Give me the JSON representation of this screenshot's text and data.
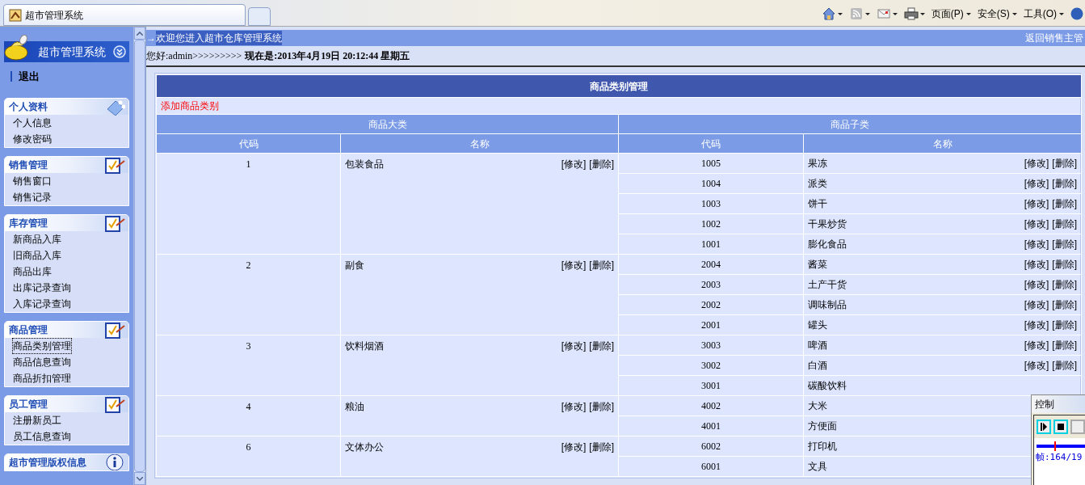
{
  "browser": {
    "tab_title": "超市管理系统",
    "menus": [
      "页面(P)",
      "安全(S)",
      "工具(O)"
    ]
  },
  "sidebar": {
    "title": "超市管理系统",
    "logout": "退出",
    "sections": [
      {
        "title": "个人资料",
        "kind": "people",
        "items": [
          {
            "label": "个人信息",
            "selected": false
          },
          {
            "label": "修改密码",
            "selected": false
          }
        ]
      },
      {
        "title": "销售管理",
        "kind": "checklist",
        "items": [
          {
            "label": "销售窗口",
            "selected": false
          },
          {
            "label": "销售记录",
            "selected": false
          }
        ]
      },
      {
        "title": "库存管理",
        "kind": "checklist",
        "items": [
          {
            "label": "新商品入库",
            "selected": false
          },
          {
            "label": "旧商品入库",
            "selected": false
          },
          {
            "label": "商品出库",
            "selected": false
          },
          {
            "label": "出库记录查询",
            "selected": false
          },
          {
            "label": "入库记录查询",
            "selected": false
          }
        ]
      },
      {
        "title": "商品管理",
        "kind": "checklist",
        "items": [
          {
            "label": "商品类别管理",
            "selected": true
          },
          {
            "label": "商品信息查询",
            "selected": false
          },
          {
            "label": "商品折扣管理",
            "selected": false
          }
        ]
      },
      {
        "title": "员工管理",
        "kind": "checklist",
        "items": [
          {
            "label": "注册新员工",
            "selected": false
          },
          {
            "label": "员工信息查询",
            "selected": false
          }
        ]
      },
      {
        "title": "超市管理版权信息",
        "kind": "info"
      }
    ]
  },
  "header": {
    "arrow": "→",
    "welcome": "欢迎您进入超市仓库管理系统",
    "back_link": "返回销售主管",
    "greeting": "您好:admin>>>>>>>>>",
    "now": "现在是:2013年4月19日  20:12:44 星期五"
  },
  "table": {
    "title": "商品类别管理",
    "add_link": "添加商品类别",
    "group_headers": [
      "商品大类",
      "商品子类"
    ],
    "columns": [
      "代码",
      "名称",
      "代码",
      "名称"
    ],
    "groups": [
      {
        "code": "1",
        "name": "包装食品",
        "actions": [
          "[修改]",
          "[删除]"
        ],
        "subs": [
          {
            "code": "1005",
            "name": "果冻",
            "actions": [
              "[修改]",
              "[删除]"
            ]
          },
          {
            "code": "1004",
            "name": "派类",
            "actions": [
              "[修改]",
              "[删除]"
            ]
          },
          {
            "code": "1003",
            "name": "饼干",
            "actions": [
              "[修改]",
              "[删除]"
            ]
          },
          {
            "code": "1002",
            "name": "干果炒货",
            "actions": [
              "[修改]",
              "[删除]"
            ]
          },
          {
            "code": "1001",
            "name": "膨化食品",
            "actions": [
              "[修改]",
              "[删除]"
            ]
          }
        ]
      },
      {
        "code": "2",
        "name": "副食",
        "actions": [
          "[修改]",
          "[删除]"
        ],
        "subs": [
          {
            "code": "2004",
            "name": "酱菜",
            "actions": [
              "[修改]",
              "[删除]"
            ]
          },
          {
            "code": "2003",
            "name": "土产干货",
            "actions": [
              "[修改]",
              "[删除]"
            ]
          },
          {
            "code": "2002",
            "name": "调味制品",
            "actions": [
              "[修改]",
              "[删除]"
            ]
          },
          {
            "code": "2001",
            "name": "罐头",
            "actions": [
              "[修改]",
              "[删除]"
            ]
          }
        ]
      },
      {
        "code": "3",
        "name": "饮料烟酒",
        "actions": [
          "[修改]",
          "[删除]"
        ],
        "subs": [
          {
            "code": "3003",
            "name": "啤酒",
            "actions": [
              "[修改]",
              "[删除]"
            ]
          },
          {
            "code": "3002",
            "name": "白酒",
            "actions": [
              "[修改]",
              "[删除]"
            ]
          },
          {
            "code": "3001",
            "name": "碳酸饮料"
          }
        ]
      },
      {
        "code": "4",
        "name": "粮油",
        "actions": [
          "[修改]",
          "[删除]"
        ],
        "subs": [
          {
            "code": "4002",
            "name": "大米"
          },
          {
            "code": "4001",
            "name": "方便面"
          }
        ]
      },
      {
        "code": "6",
        "name": "文体办公",
        "actions": [
          "[修改]",
          "[删除]"
        ],
        "subs": [
          {
            "code": "6002",
            "name": "打印机"
          },
          {
            "code": "6001",
            "name": "文具"
          }
        ]
      }
    ]
  },
  "control_window": {
    "title": "控制",
    "slider": {
      "level": 0.35
    },
    "frame": "帧:164/19"
  }
}
